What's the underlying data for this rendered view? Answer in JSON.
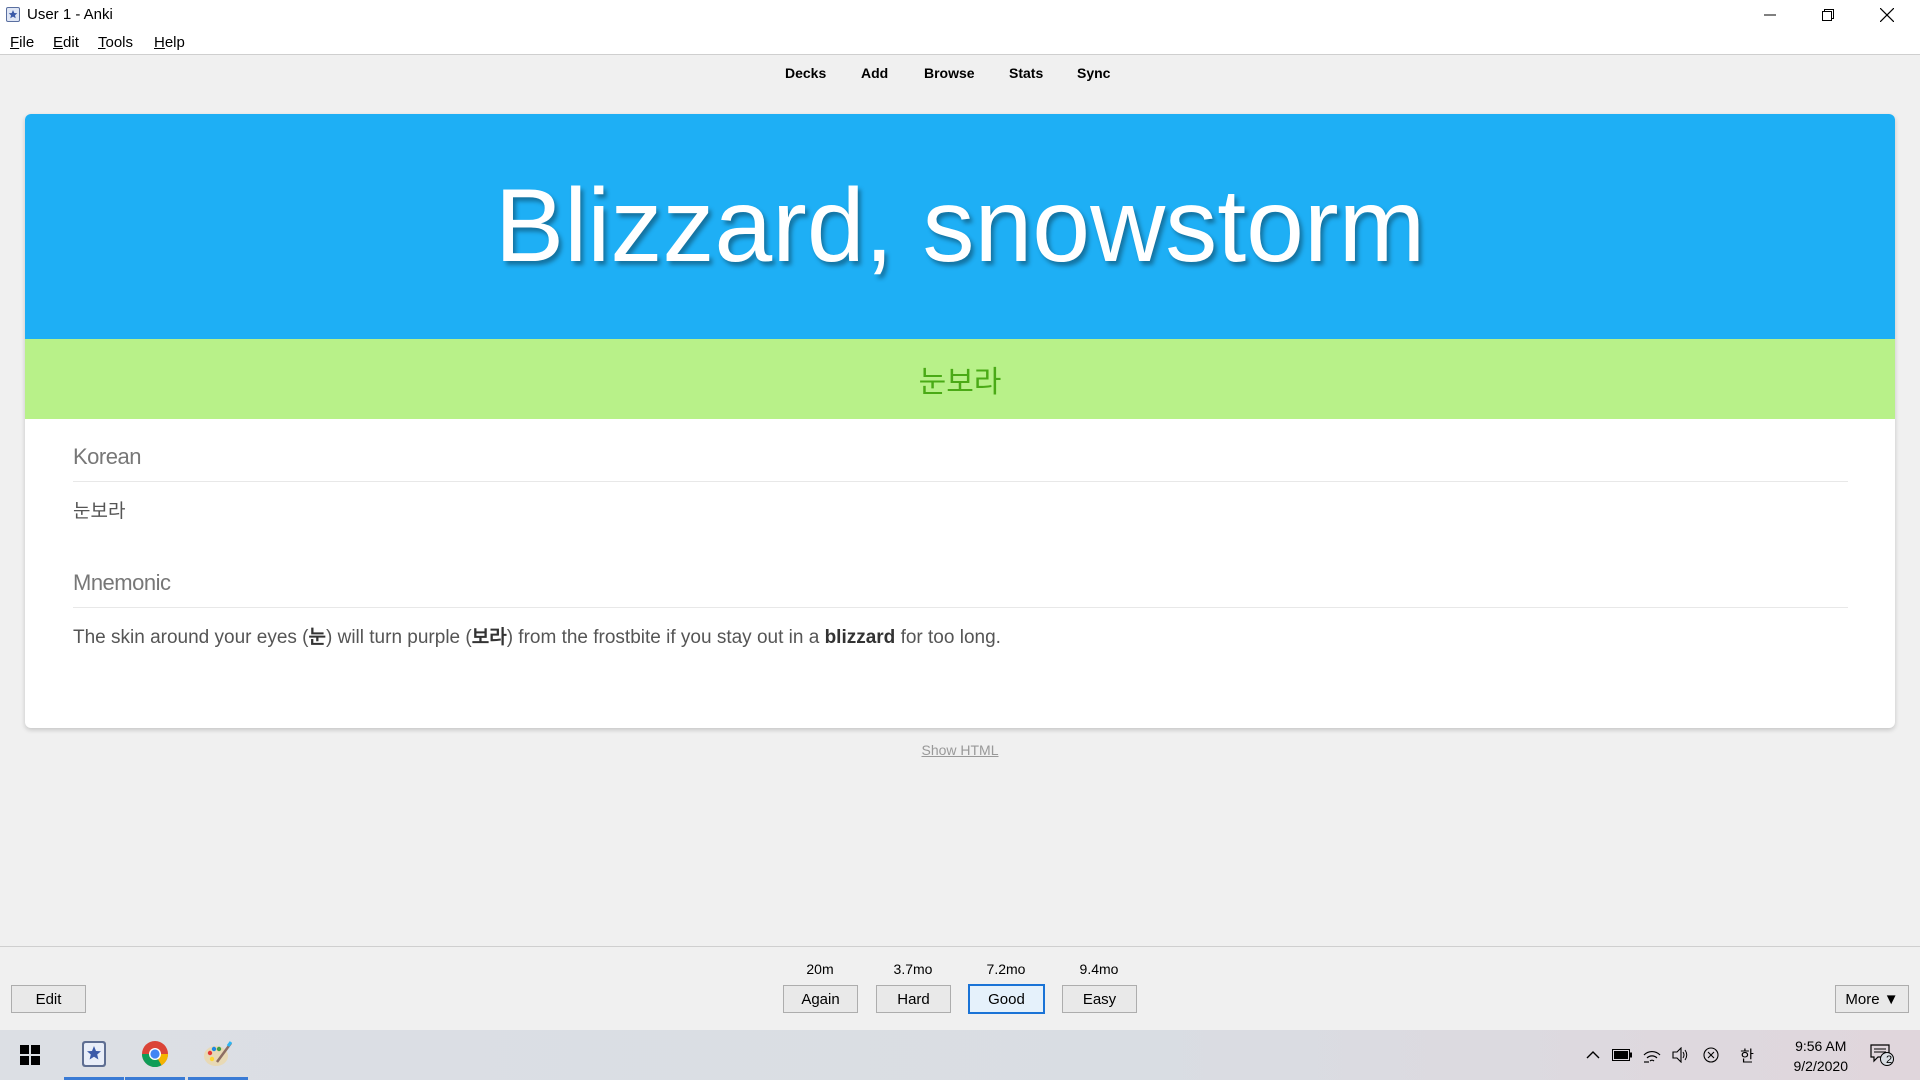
{
  "window": {
    "title": "User 1 - Anki",
    "app_icon": "anki-star-icon",
    "controls": [
      "minimize-icon",
      "restore-icon",
      "close-icon"
    ]
  },
  "menu": {
    "file": {
      "accel": "F",
      "rest": "ile"
    },
    "edit": {
      "accel": "E",
      "rest": "dit"
    },
    "tools": {
      "accel": "T",
      "rest": "ools"
    },
    "help": {
      "accel": "H",
      "rest": "elp"
    }
  },
  "toolbar": {
    "decks": "Decks",
    "add": "Add",
    "browse": "Browse",
    "stats": "Stats",
    "sync": "Sync"
  },
  "card": {
    "front": "Blizzard, snowstorm",
    "answer": "눈보라",
    "header_color": "#1eaff5",
    "answer_band_color": "#b8f189",
    "answer_text_color": "#4aaa16",
    "korean_heading": "Korean",
    "korean_value": "눈보라",
    "mnemonic_heading": "Mnemonic",
    "mnemonic": {
      "p1": "The skin around your eyes (",
      "b1": "눈",
      "p2": ") will turn purple (",
      "b2": "보라",
      "p3": ") from the frostbite if you stay out in a ",
      "b3": "blizzard",
      "p4": " for too long."
    }
  },
  "show_html": "Show HTML",
  "answer_bar": {
    "edit": "Edit",
    "more": "More ▼",
    "buttons": [
      {
        "label": "Again",
        "interval": "20m"
      },
      {
        "label": "Hard",
        "interval": "3.7mo"
      },
      {
        "label": "Good",
        "interval": "7.2mo"
      },
      {
        "label": "Easy",
        "interval": "9.4mo"
      }
    ],
    "default_button": "Good",
    "default_color": "#1a73d6"
  },
  "taskbar": {
    "apps": [
      "windows-start-icon",
      "anki-icon",
      "chrome-icon",
      "paint-icon"
    ],
    "tray_icons": [
      "chevron-up-icon",
      "battery-icon",
      "wifi-icon",
      "volume-icon",
      "blocked-icon"
    ],
    "ime": "한",
    "time": "9:56 AM",
    "date": "9/2/2020",
    "notification_count": "2"
  }
}
